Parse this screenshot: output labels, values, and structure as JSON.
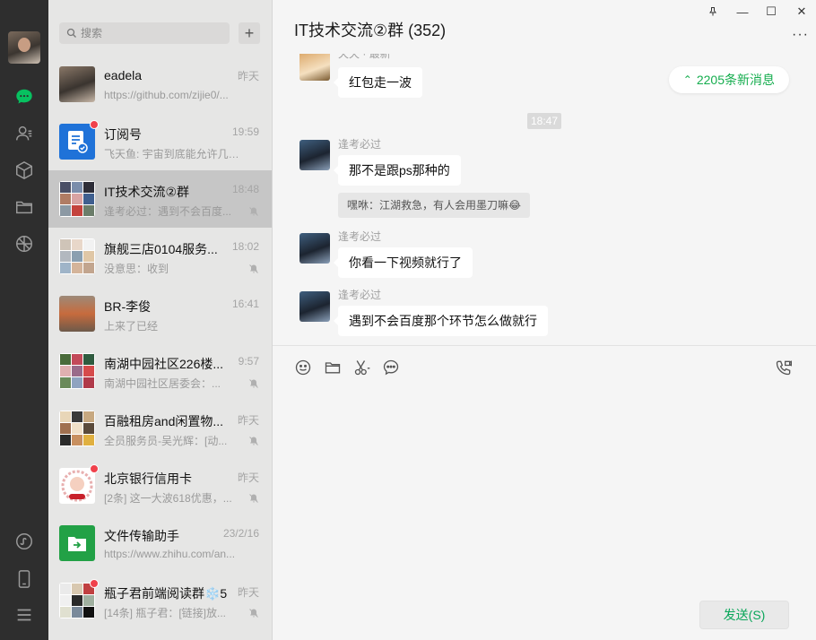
{
  "sidebar_rail": {
    "icons": [
      "avatar",
      "chat-icon",
      "contacts-icon",
      "favorites-cube-icon",
      "folder-icon",
      "moments-icon",
      "mini-program-icon",
      "phone-icon",
      "menu-icon"
    ]
  },
  "search": {
    "placeholder": "搜索",
    "add_label": "+"
  },
  "conversations": [
    {
      "name": "eadela",
      "time": "昨天",
      "snippet": "https://github.com/zijie0/...",
      "muted": false,
      "unread": false
    },
    {
      "name": "订阅号",
      "time": "19:59",
      "snippet": "飞天鱼: 宇宙到底能允许几位...",
      "muted": false,
      "unread": true
    },
    {
      "name": "IT技术交流②群",
      "time": "18:48",
      "snippet": "逢考必过：遇到不会百度...",
      "muted": true,
      "unread": false,
      "active": true
    },
    {
      "name": "旗舰三店0104服务...",
      "time": "18:02",
      "snippet": "没意思：收到",
      "muted": true,
      "unread": false
    },
    {
      "name": "BR-李俊",
      "time": "16:41",
      "snippet": "上来了已经",
      "muted": false,
      "unread": false
    },
    {
      "name": "南湖中园社区226楼...",
      "time": "9:57",
      "snippet": "南湖中园社区居委会：...",
      "muted": true,
      "unread": false
    },
    {
      "name": "百融租房and闲置物...",
      "time": "昨天",
      "snippet": "全员服务员-吴光辉：[动...",
      "muted": true,
      "unread": false
    },
    {
      "name": "北京银行信用卡",
      "time": "昨天",
      "snippet": "[2条] 这一大波618优惠，...",
      "muted": true,
      "unread": true
    },
    {
      "name": "文件传输助手",
      "time": "23/2/16",
      "snippet": "https://www.zhihu.com/an...",
      "muted": false,
      "unread": false
    },
    {
      "name": "瓶子君前端阅读群❄️5",
      "time": "昨天",
      "snippet": "[14条] 瓶子君：[链接]放...",
      "muted": true,
      "unread": true
    }
  ],
  "chat": {
    "title": "IT技术交流②群 (352)",
    "more_label": "···",
    "new_messages_badge": "2205条新消息",
    "top_sender": "天天 · 最新",
    "top_message": "红包走一波",
    "timestamp": "18:47",
    "messages": [
      {
        "sender": "逢考必过",
        "text": "那不是跟ps那种的",
        "quote": "嘿咻：江湖救急，有人会用墨刀嘛😂"
      },
      {
        "sender": "逢考必过",
        "text": "你看一下视频就行了"
      },
      {
        "sender": "逢考必过",
        "text": "遇到不会百度那个环节怎么做就行"
      }
    ],
    "send_label": "发送(S)"
  },
  "window_controls": {
    "pin": "⊥",
    "minimize": "—",
    "maximize": "☐",
    "close": "✕"
  },
  "colors": {
    "rail": "#2e2e2e",
    "accent_green": "#07c160",
    "new_msg_green": "#15ad4e",
    "unread_red": "#f0414b"
  }
}
